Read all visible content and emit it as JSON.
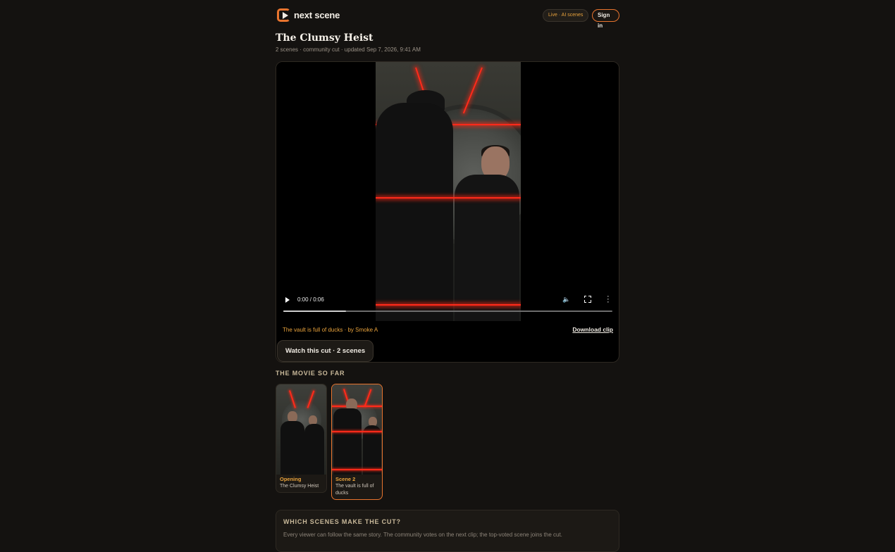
{
  "header": {
    "brand": "next scene",
    "live_pill": "Live · AI scenes",
    "signin_label": "Sign in"
  },
  "page": {
    "title": "The Clumsy Heist",
    "meta": "2 scenes · community cut · updated Sep 7, 2026, 9:41 AM"
  },
  "player": {
    "time": "0:00 / 0:06",
    "progress": 0.19,
    "caption": "The vault is full of ducks · by Smoke A",
    "download_label": "Download clip",
    "watch_label": "Watch this cut · 2 scenes"
  },
  "movie_so_far": {
    "label": "THE MOVIE SO FAR",
    "scenes": [
      {
        "label": "Opening",
        "subtitle": "The Clumsy Heist",
        "active": false
      },
      {
        "label": "Scene 2",
        "subtitle": "The vault is full of ducks",
        "active": true
      }
    ]
  },
  "which_scenes": {
    "title": "WHICH SCENES MAKE THE CUT?",
    "text": "Every viewer can follow the same story. The community votes on the next clip; the top-voted scene joins the cut."
  },
  "colors": {
    "accent": "#e8742e",
    "accent_text": "#e8a23c",
    "background": "#141210"
  }
}
